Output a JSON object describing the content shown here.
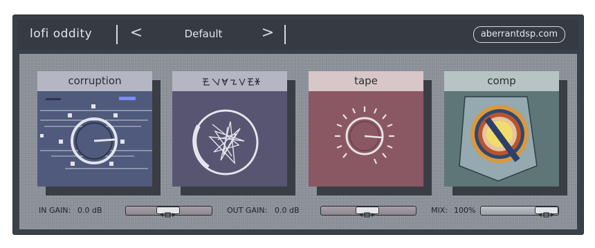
{
  "header": {
    "title": "lofi oddity",
    "prev_icon": "chevron-left-icon",
    "next_icon": "chevron-right-icon",
    "prev_glyph": "<",
    "next_glyph": ">",
    "preset": "Default",
    "website": "aberrantdsp.com"
  },
  "modules": [
    {
      "label": "corruption",
      "head_color": "#b4b7c3",
      "face_color": "#4f5a7c",
      "icon": "corruption-knob-icon"
    },
    {
      "label": "",
      "head_color": "#b6b5c4",
      "face_color": "#575572",
      "icon": "glitch-knob-icon"
    },
    {
      "label": "tape",
      "head_color": "#d8c7c8",
      "face_color": "#8a5863",
      "icon": "tape-knob-icon"
    },
    {
      "label": "comp",
      "head_color": "#b7c4c4",
      "face_color": "#5e7677",
      "icon": "comp-knob-icon"
    }
  ],
  "controls": {
    "in_gain": {
      "label": "IN GAIN:",
      "value": "0.0 dB",
      "position": 0.5
    },
    "out_gain": {
      "label": "OUT GAIN:",
      "value": "0.0 dB",
      "position": 0.5
    },
    "mix": {
      "label": "MIX:",
      "value": "100%",
      "position": 1.0
    }
  }
}
